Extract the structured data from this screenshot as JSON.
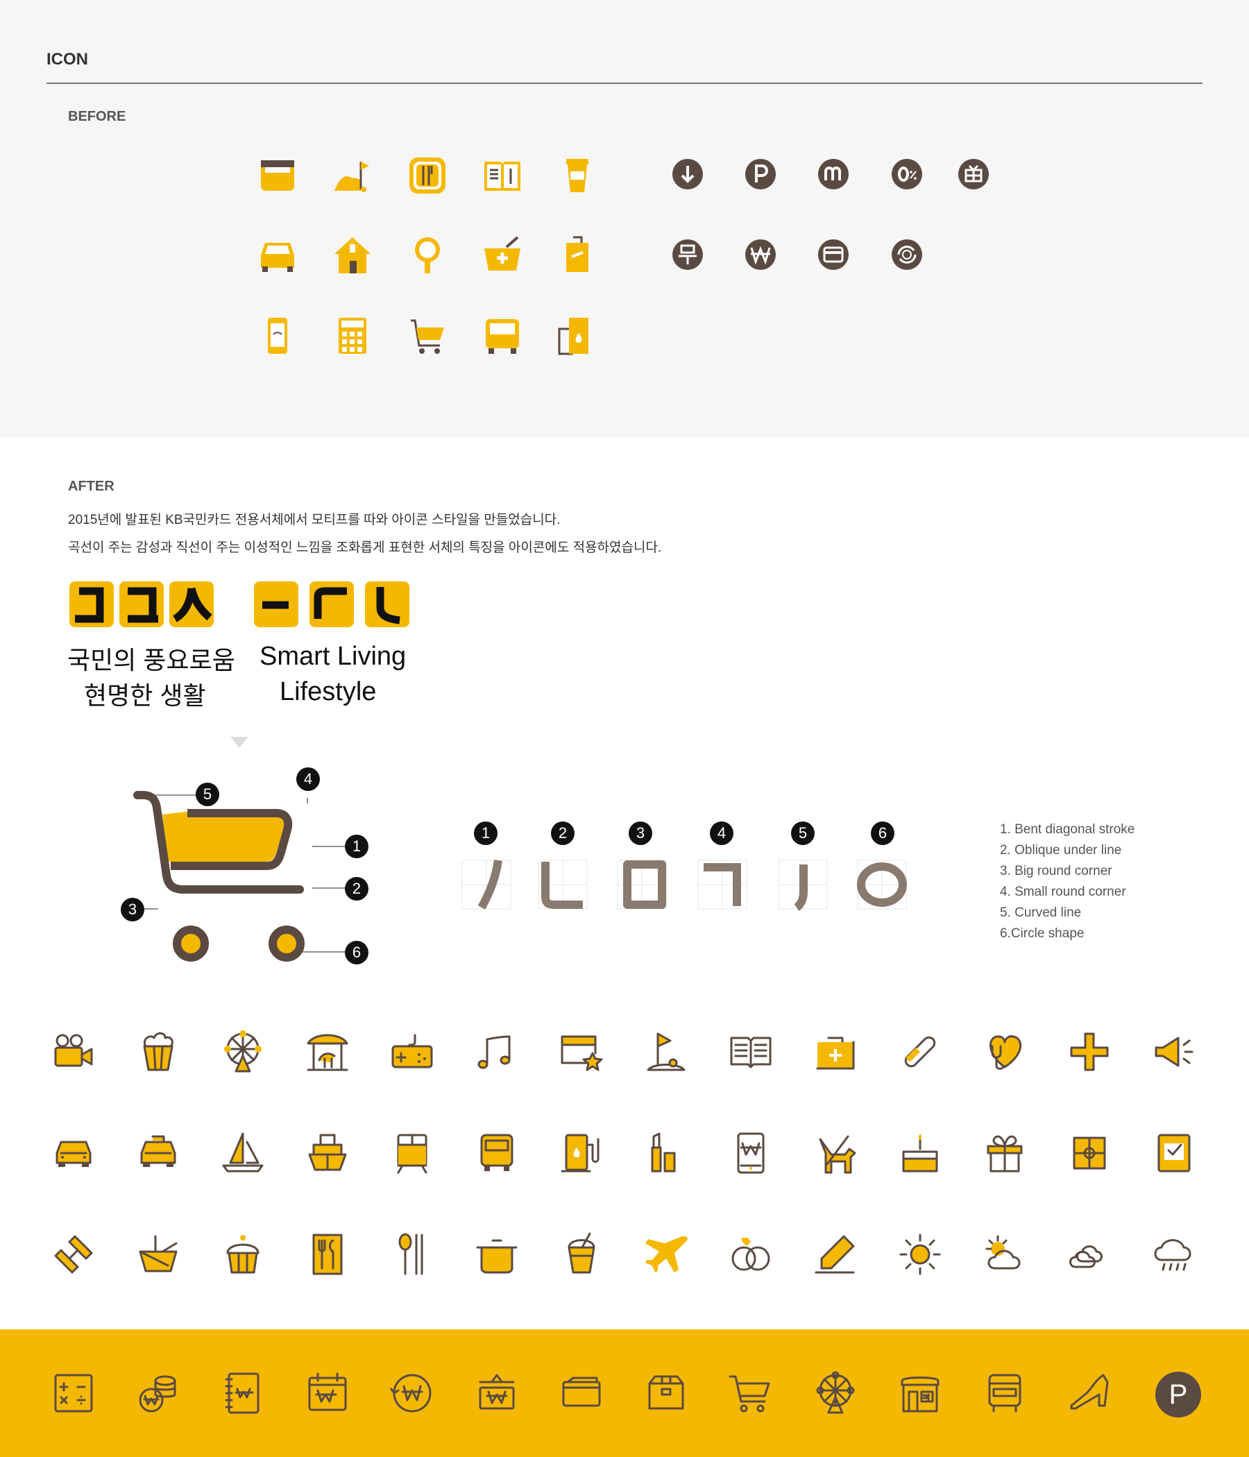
{
  "section_title": "ICON",
  "before": {
    "label": "BEFORE",
    "icons_left": [
      "popcorn-icon",
      "golf-icon",
      "dining-icon",
      "book-icon",
      "coffee-icon",
      "car-icon",
      "house-icon",
      "mirror-icon",
      "pharmacy-icon",
      "luggage-icon",
      "phone-icon",
      "calculator-icon",
      "cart-icon",
      "bus-icon",
      "gas-icon"
    ],
    "icons_right": [
      "download-icon",
      "parking-icon",
      "m-icon",
      "zero-percent-icon",
      "gift-icon",
      "free-icon",
      "won-icon",
      "card-icon",
      "exchange-icon"
    ]
  },
  "after": {
    "label": "AFTER",
    "desc_line1": "2015년에 발표된 KB국민카드 전용서체에서 모티프를 따와 아이콘 스타일을 만들었습니다.",
    "desc_line2": "곡선이 주는 감성과 직선이 주는 이성적인 느낌을 조화롭게 표현한 서체의 특징을 아이콘에도 적용하였습니다.",
    "slogan_ko_line1": "국민의 풍요로움",
    "slogan_ko_line2": "현명한 생활",
    "slogan_en_line1": "Smart Living",
    "slogan_en_line2": "Lifestyle",
    "callout_numbers": [
      "1",
      "2",
      "3",
      "4",
      "5",
      "6"
    ],
    "features": [
      "1. Bent diagonal stroke",
      "2. Oblique under line",
      "3. Big round corner",
      "4. Small round corner",
      "5. Curved line",
      "6.Circle shape"
    ],
    "p_label": "P"
  },
  "colors": {
    "accent": "#f5b800",
    "brown": "#5a4a42",
    "before_bg": "#f6f6f6",
    "after_bg": "#ffffff",
    "band_bg": "#f5b800"
  }
}
